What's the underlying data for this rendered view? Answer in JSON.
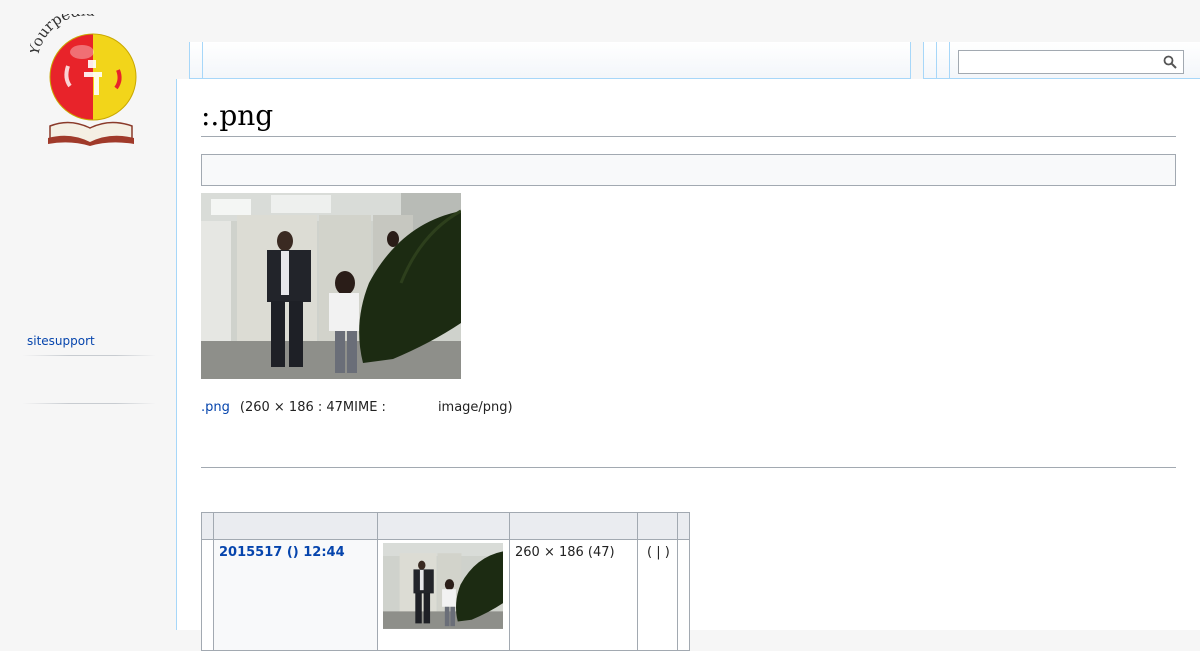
{
  "site": {
    "logo_text": "Yourpedia"
  },
  "sidebar": {
    "items": [
      {
        "label": "sitesupport"
      }
    ]
  },
  "search": {
    "value": "",
    "placeholder": ""
  },
  "page": {
    "title": ":.png"
  },
  "file": {
    "name": ".png",
    "meta": "(260 × 186 : 47MIME :",
    "mime": "image/png)"
  },
  "history": {
    "rows": [
      {
        "date": "2015517 () 12:44",
        "dimensions": "260 × 186 (47)",
        "actions": "( | )"
      }
    ]
  },
  "colors": {
    "link": "#0645ad",
    "border": "#a7d7f9",
    "rule": "#a2a9b1",
    "logo_red": "#e8232a",
    "logo_yellow": "#f2d51a"
  },
  "icons": [
    "logo-globe-icon",
    "search-icon"
  ]
}
